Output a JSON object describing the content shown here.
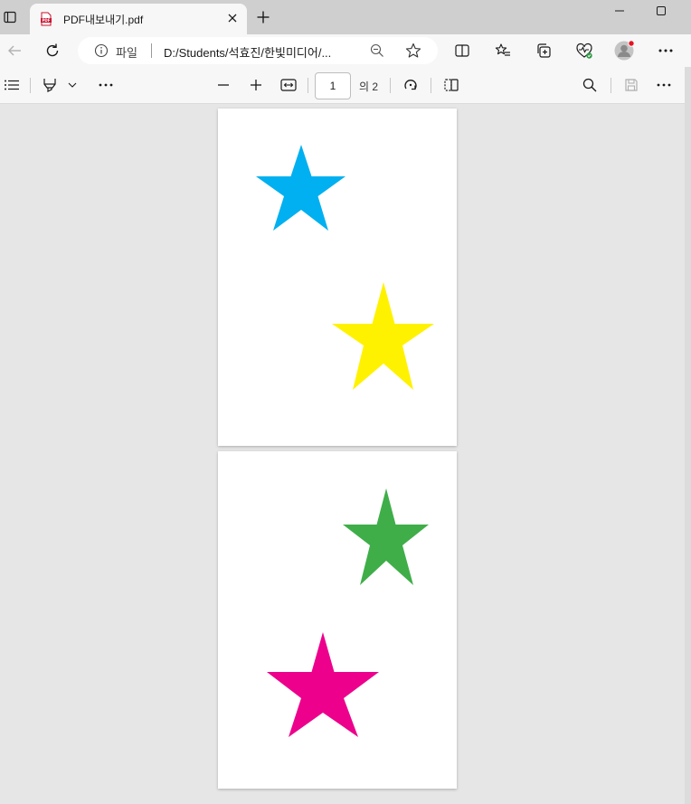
{
  "tab": {
    "title": "PDF내보내기.pdf",
    "favicon_label": "PDF"
  },
  "address_bar": {
    "scheme_label": "파일",
    "url": "D:/Students/석효진/한빛미디어/..."
  },
  "pdf_toolbar": {
    "current_page": "1",
    "page_total": "의 2"
  },
  "colors": {
    "tab_strip_bg": "#cfcfcf",
    "toolbar_bg": "#f7f7f7",
    "viewer_bg": "#e6e6e6",
    "profile_badge": "#e81123"
  },
  "icons": {
    "tab_actions": "tab-actions-icon",
    "pdf_favicon": "pdf-file-icon",
    "close": "close-icon",
    "new_tab": "plus-icon",
    "back": "back-arrow-icon",
    "refresh": "refresh-icon",
    "info": "info-icon",
    "zoom": "zoom-out-icon",
    "favorite": "star-outline-icon",
    "split_screen": "split-screen-icon",
    "favorites": "favorites-list-icon",
    "collections": "collections-icon",
    "health": "browser-essentials-icon",
    "profile": "profile-avatar-icon",
    "menu": "more-options-icon",
    "contents": "table-of-contents-icon",
    "draw": "highlighter-icon",
    "zoom_minus": "minus-icon",
    "zoom_plus": "plus-icon",
    "fit": "fit-to-width-icon",
    "rotate": "rotate-icon",
    "page_view": "page-view-icon",
    "search": "search-icon",
    "save": "save-icon"
  },
  "pages": [
    {
      "stars": [
        {
          "color": "#00b0f0",
          "name": "blue-star"
        },
        {
          "color": "#fff200",
          "name": "yellow-star"
        }
      ]
    },
    {
      "stars": [
        {
          "color": "#3fae49",
          "name": "green-star"
        },
        {
          "color": "#ec008c",
          "name": "magenta-star"
        }
      ]
    }
  ]
}
